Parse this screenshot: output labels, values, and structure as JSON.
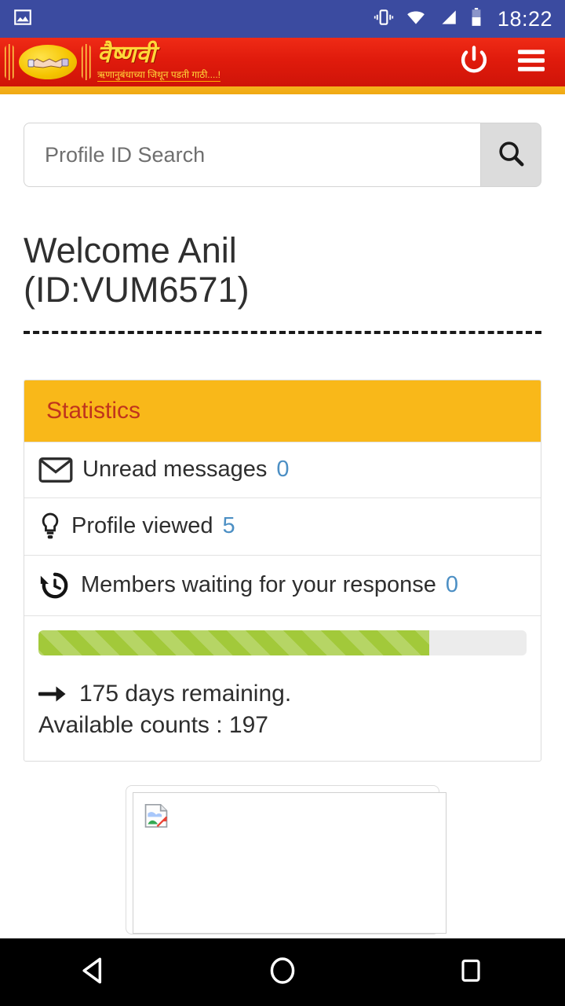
{
  "status_bar": {
    "time": "18:22",
    "icons": [
      "screenshot-image-icon",
      "vibrate-icon",
      "wifi-icon",
      "cellular-signal-icon",
      "battery-icon"
    ],
    "background_color": "#3b4ba0"
  },
  "app_bar": {
    "brand_title": "वैष्णवी",
    "brand_tagline": "ऋणानुबंधाच्या जिथून पडती गाठी....!",
    "background_color": "#e01b0c",
    "accent_strip_color": "#f6b31c",
    "brand_text_color": "#ffd83a",
    "actions": [
      {
        "name": "power-logout-button",
        "icon": "power-icon"
      },
      {
        "name": "menu-button",
        "icon": "hamburger-menu-icon"
      }
    ]
  },
  "search": {
    "placeholder": "Profile ID Search",
    "value": "",
    "button_icon": "search-icon"
  },
  "welcome": {
    "line1": "Welcome Anil",
    "line2": "(ID:VUM6571)"
  },
  "statistics": {
    "title": "Statistics",
    "header_bg": "#f9b819",
    "header_text_color": "#c0341d",
    "rows": [
      {
        "icon": "envelope-icon",
        "label": "Unread messages",
        "value": "0",
        "spaced": false
      },
      {
        "icon": "lightbulb-icon",
        "label": "Profile viewed",
        "value": "5",
        "spaced": true
      },
      {
        "icon": "history-clock-icon",
        "label": "Members waiting for your response",
        "value": "0",
        "spaced": true
      }
    ],
    "progress": {
      "percent": 80,
      "fill_color": "#a2c93a",
      "track_color": "#ececec"
    },
    "days_remaining": "175 days remaining.",
    "days_icon": "arrow-right-icon",
    "available_counts": "Available counts : 197"
  },
  "photo_card": {
    "image_state": "broken-image-placeholder"
  },
  "nav_bar": {
    "buttons": [
      {
        "name": "nav-back-button",
        "icon": "back-triangle-icon"
      },
      {
        "name": "nav-home-button",
        "icon": "home-circle-icon"
      },
      {
        "name": "nav-recents-button",
        "icon": "recents-square-icon"
      }
    ],
    "background_color": "#000000"
  }
}
